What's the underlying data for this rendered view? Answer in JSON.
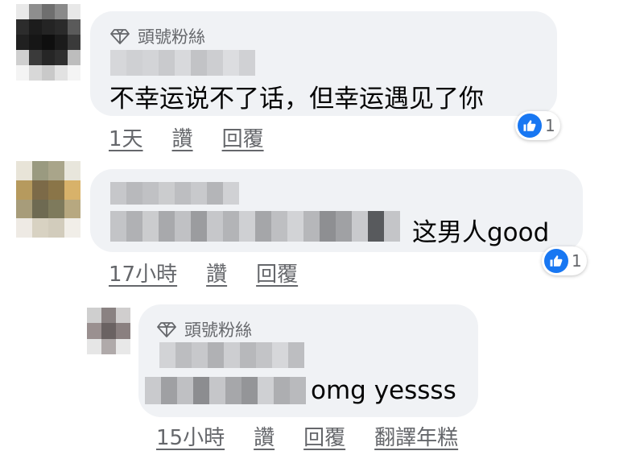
{
  "comments": [
    {
      "badge": "頭號粉絲",
      "text": "不幸运说不了话，但幸运遇见了你",
      "reaction_count": "1",
      "time": "1天",
      "like": "讚",
      "reply": "回覆"
    },
    {
      "text": "这男人good",
      "reaction_count": "1",
      "time": "17小時",
      "like": "讚",
      "reply": "回覆"
    },
    {
      "badge": "頭號粉絲",
      "text": "omg yessss",
      "time": "15小時",
      "like": "讚",
      "reply": "回覆",
      "translate": "翻譯年糕"
    }
  ],
  "colors": {
    "bubble": "#f0f2f5",
    "secondary_text": "#65676b",
    "like_blue": "#1877f2"
  }
}
